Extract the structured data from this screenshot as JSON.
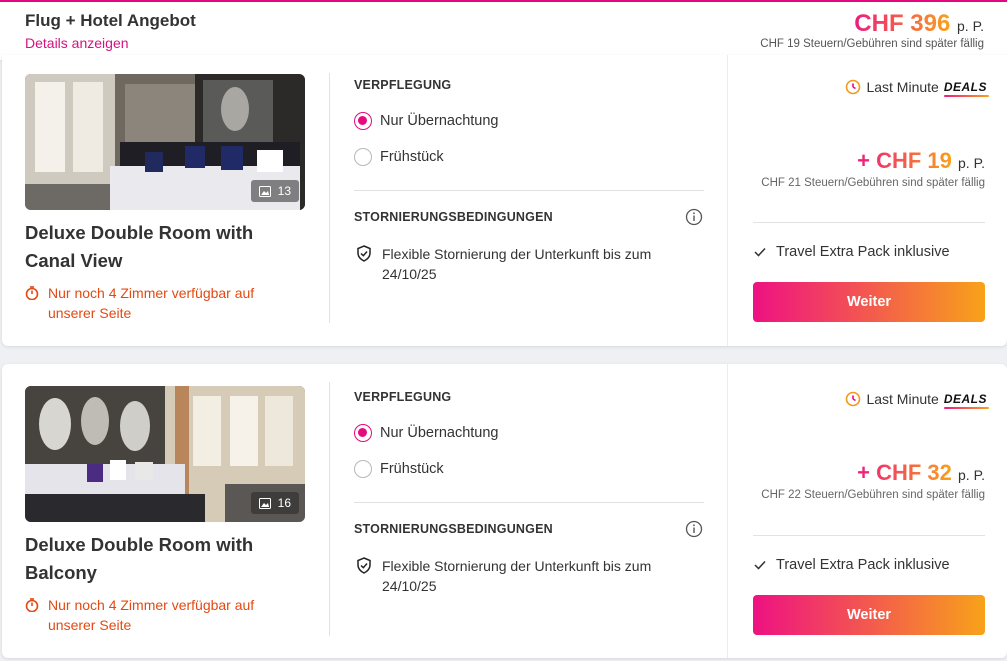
{
  "header": {
    "title": "Flug + Hotel Angebot",
    "details_link": "Details anzeigen",
    "price": "CHF 396",
    "per_person": "p. P.",
    "taxes_note": "CHF 19 Steuern/Gebühren sind später fällig"
  },
  "colors": {
    "brand_pink": "#e6097f",
    "brand_orange": "#f8a21a",
    "availability": "#e24a12"
  },
  "rooms": [
    {
      "name": "Deluxe Double Room with Canal View",
      "photo_count": "13",
      "availability": "Nur noch 4 Zimmer verfügbar auf unserer Seite",
      "board_label": "VERPFLEGUNG",
      "board_options": [
        {
          "label": "Nur Übernachtung",
          "selected": true
        },
        {
          "label": "Frühstück",
          "selected": false
        }
      ],
      "cancellation_label": "STORNIERUNGSBEDINGUNGEN",
      "cancellation_text": "Flexible Stornierung der Unterkunft bis zum 24/10/25",
      "last_minute": "Last Minute",
      "deals": "DEALS",
      "addon_price": "+ CHF 19",
      "per_person": "p. P.",
      "addon_taxes": "CHF 21 Steuern/Gebühren sind später fällig",
      "extra_pack": "Travel Extra Pack inklusive",
      "button": "Weiter"
    },
    {
      "name": "Deluxe Double Room with Balcony",
      "photo_count": "16",
      "availability": "Nur noch 4 Zimmer verfügbar auf unserer Seite",
      "board_label": "VERPFLEGUNG",
      "board_options": [
        {
          "label": "Nur Übernachtung",
          "selected": true
        },
        {
          "label": "Frühstück",
          "selected": false
        }
      ],
      "cancellation_label": "STORNIERUNGSBEDINGUNGEN",
      "cancellation_text": "Flexible Stornierung der Unterkunft bis zum 24/10/25",
      "last_minute": "Last Minute",
      "deals": "DEALS",
      "addon_price": "+ CHF 32",
      "per_person": "p. P.",
      "addon_taxes": "CHF 22 Steuern/Gebühren sind später fällig",
      "extra_pack": "Travel Extra Pack inklusive",
      "button": "Weiter"
    }
  ]
}
